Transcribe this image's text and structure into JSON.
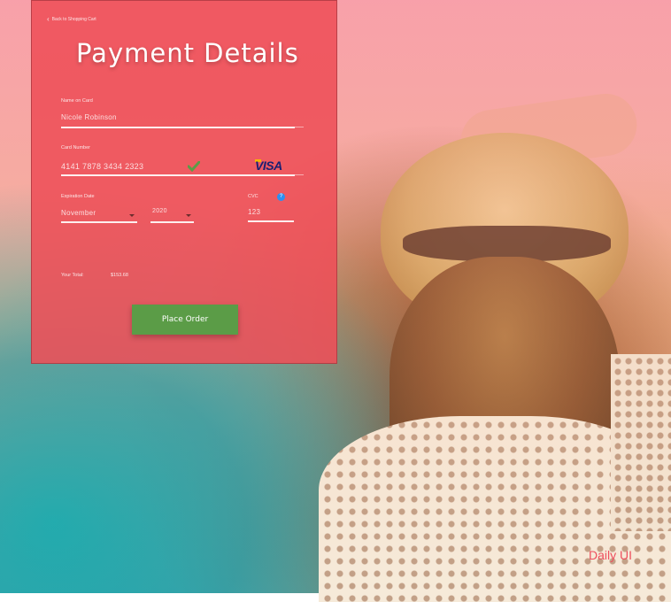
{
  "nav": {
    "back_label": "Back to Shopping Cart"
  },
  "page": {
    "title": "Payment Details"
  },
  "form": {
    "name_label": "Name on Card",
    "name_value": "Nicole Robinson",
    "card_label": "Card Number",
    "card_value": "4141 7878 3434 2323",
    "card_brand": "VISA",
    "exp_label": "Expiration Date",
    "exp_month": "November",
    "exp_year": "2020",
    "cvc_label": "CVC",
    "cvc_help": "?",
    "cvc_value": "123"
  },
  "summary": {
    "total_label": "Your Total:",
    "total_value": "$153.68"
  },
  "actions": {
    "place_order": "Place Order"
  },
  "brand": {
    "watermark": "Daily UI"
  },
  "colors": {
    "panel": "#EE4E58",
    "button": "#5B9C47",
    "valid_check": "#5B9C47",
    "help": "#2D8FF0"
  }
}
